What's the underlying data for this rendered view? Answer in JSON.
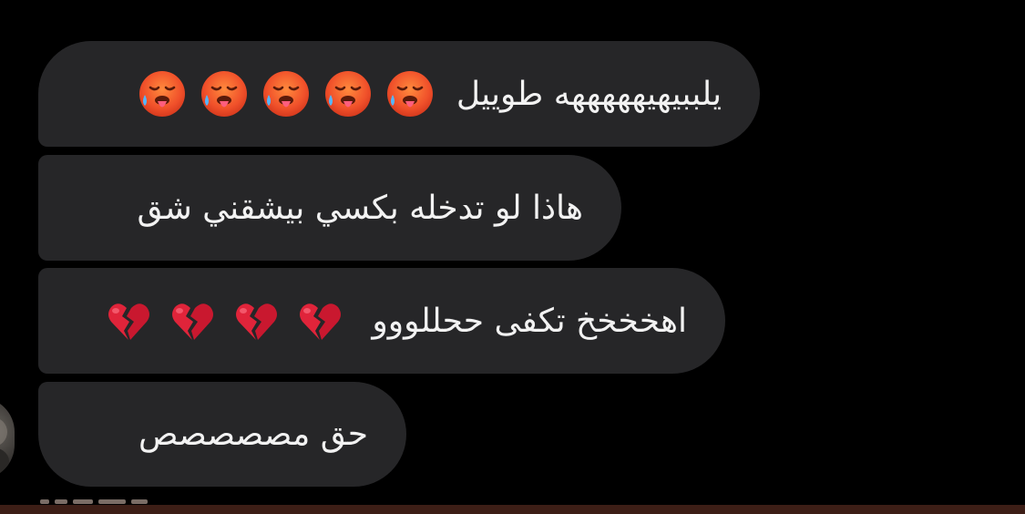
{
  "messages": [
    {
      "text": "يلببيهيهههههه طوييل",
      "emoji_icon": "hot-face-icon",
      "emoji_count": 5
    },
    {
      "text": "هاذا لو تدخله بكسي بيشقني شق"
    },
    {
      "text": "اهخخخخ تكفى ححللووو",
      "emoji_icon": "broken-heart-icon",
      "emoji_count": 4
    },
    {
      "text": "حق مصصصصص"
    }
  ],
  "colors": {
    "background": "#000000",
    "bubble": "#262628",
    "text": "#f2f2f2",
    "hot_face": "#f25a2a",
    "broken_heart": "#e0243a"
  }
}
